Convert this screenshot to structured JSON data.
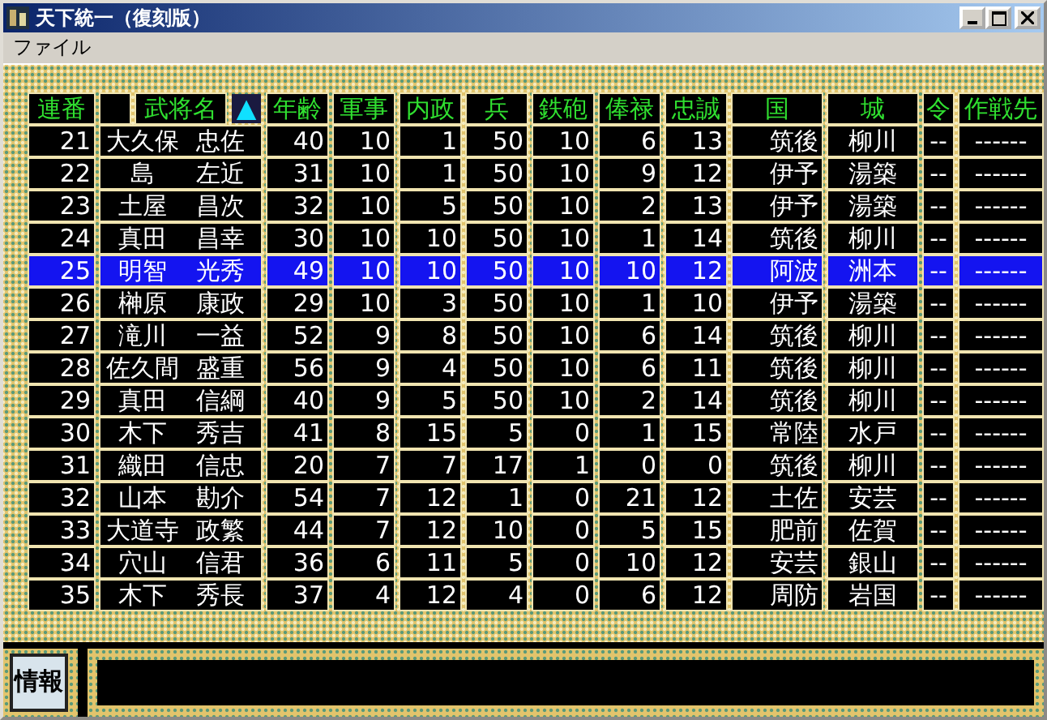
{
  "window": {
    "title": "天下統一（復刻版）"
  },
  "menu": [
    "ファイル"
  ],
  "headers": [
    {
      "kind": "label",
      "label": "連番"
    },
    {
      "kind": "blank"
    },
    {
      "kind": "label",
      "label": "武将名"
    },
    {
      "kind": "sort",
      "label": "▲"
    },
    {
      "kind": "label",
      "label": "年齢"
    },
    {
      "kind": "label",
      "label": "軍事"
    },
    {
      "kind": "label",
      "label": "内政"
    },
    {
      "kind": "label",
      "label": "兵"
    },
    {
      "kind": "label",
      "label": "鉄砲"
    },
    {
      "kind": "label",
      "label": "俸禄"
    },
    {
      "kind": "label",
      "label": "忠誠"
    },
    {
      "kind": "label",
      "label": "国"
    },
    {
      "kind": "label",
      "label": "城"
    },
    {
      "kind": "label",
      "label": "令"
    },
    {
      "kind": "label",
      "label": "作戦先"
    }
  ],
  "rows": [
    {
      "selected": false,
      "no": "21",
      "family": "大久保",
      "given": "忠佐",
      "stats": [
        "40",
        "10",
        "1",
        "50",
        "10",
        "6",
        "13"
      ],
      "province": "筑後",
      "castle": "柳川",
      "order": "--",
      "target": "------"
    },
    {
      "selected": false,
      "no": "22",
      "family": "島",
      "given": "左近",
      "stats": [
        "31",
        "10",
        "1",
        "50",
        "10",
        "9",
        "12"
      ],
      "province": "伊予",
      "castle": "湯築",
      "order": "--",
      "target": "------"
    },
    {
      "selected": false,
      "no": "23",
      "family": "土屋",
      "given": "昌次",
      "stats": [
        "32",
        "10",
        "5",
        "50",
        "10",
        "2",
        "13"
      ],
      "province": "伊予",
      "castle": "湯築",
      "order": "--",
      "target": "------"
    },
    {
      "selected": false,
      "no": "24",
      "family": "真田",
      "given": "昌幸",
      "stats": [
        "30",
        "10",
        "10",
        "50",
        "10",
        "1",
        "14"
      ],
      "province": "筑後",
      "castle": "柳川",
      "order": "--",
      "target": "------"
    },
    {
      "selected": true,
      "no": "25",
      "family": "明智",
      "given": "光秀",
      "stats": [
        "49",
        "10",
        "10",
        "50",
        "10",
        "10",
        "12"
      ],
      "province": "阿波",
      "castle": "洲本",
      "order": "--",
      "target": "------"
    },
    {
      "selected": false,
      "no": "26",
      "family": "榊原",
      "given": "康政",
      "stats": [
        "29",
        "10",
        "3",
        "50",
        "10",
        "1",
        "10"
      ],
      "province": "伊予",
      "castle": "湯築",
      "order": "--",
      "target": "------"
    },
    {
      "selected": false,
      "no": "27",
      "family": "滝川",
      "given": "一益",
      "stats": [
        "52",
        "9",
        "8",
        "50",
        "10",
        "6",
        "14"
      ],
      "province": "筑後",
      "castle": "柳川",
      "order": "--",
      "target": "------"
    },
    {
      "selected": false,
      "no": "28",
      "family": "佐久間",
      "given": "盛重",
      "stats": [
        "56",
        "9",
        "4",
        "50",
        "10",
        "6",
        "11"
      ],
      "province": "筑後",
      "castle": "柳川",
      "order": "--",
      "target": "------"
    },
    {
      "selected": false,
      "no": "29",
      "family": "真田",
      "given": "信綱",
      "stats": [
        "40",
        "9",
        "5",
        "50",
        "10",
        "2",
        "14"
      ],
      "province": "筑後",
      "castle": "柳川",
      "order": "--",
      "target": "------"
    },
    {
      "selected": false,
      "no": "30",
      "family": "木下",
      "given": "秀吉",
      "stats": [
        "41",
        "8",
        "15",
        "5",
        "0",
        "1",
        "15"
      ],
      "province": "常陸",
      "castle": "水戸",
      "order": "--",
      "target": "------"
    },
    {
      "selected": false,
      "no": "31",
      "family": "織田",
      "given": "信忠",
      "stats": [
        "20",
        "7",
        "7",
        "17",
        "1",
        "0",
        "0"
      ],
      "province": "筑後",
      "castle": "柳川",
      "order": "--",
      "target": "------"
    },
    {
      "selected": false,
      "no": "32",
      "family": "山本",
      "given": "勘介",
      "stats": [
        "54",
        "7",
        "12",
        "1",
        "0",
        "21",
        "12"
      ],
      "province": "土佐",
      "castle": "安芸",
      "order": "--",
      "target": "------"
    },
    {
      "selected": false,
      "no": "33",
      "family": "大道寺",
      "given": "政繁",
      "stats": [
        "44",
        "7",
        "12",
        "10",
        "0",
        "5",
        "15"
      ],
      "province": "肥前",
      "castle": "佐賀",
      "order": "--",
      "target": "------"
    },
    {
      "selected": false,
      "no": "34",
      "family": "穴山",
      "given": "信君",
      "stats": [
        "36",
        "6",
        "11",
        "5",
        "0",
        "10",
        "12"
      ],
      "province": "安芸",
      "castle": "銀山",
      "order": "--",
      "target": "------"
    },
    {
      "selected": false,
      "no": "35",
      "family": "木下",
      "given": "秀長",
      "stats": [
        "37",
        "4",
        "12",
        "4",
        "0",
        "6",
        "12"
      ],
      "province": "周防",
      "castle": "岩国",
      "order": "--",
      "target": "------"
    }
  ],
  "info_button": {
    "label": "情報"
  }
}
